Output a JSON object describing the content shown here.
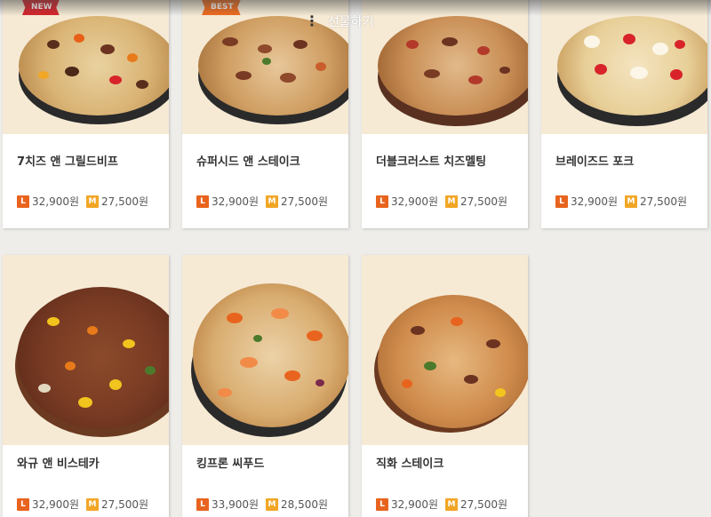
{
  "header": {
    "gift_label": "선물하기",
    "menu_dots": "⋮"
  },
  "colors": {
    "size_l": "#e8641e",
    "size_m": "#f2a626",
    "badge_new": "#d8232a",
    "badge_best": "#f26b1d",
    "photo_bg": "#f6ead5",
    "page_bg": "#eeedea"
  },
  "menu": [
    {
      "name": "7치즈 앤 그릴드비프",
      "badge": "NEW",
      "l_size": "L",
      "l_price": "32,900원",
      "m_size": "M",
      "m_price": "27,500원"
    },
    {
      "name": "슈퍼시드 앤 스테이크",
      "badge": "BEST",
      "l_size": "L",
      "l_price": "32,900원",
      "m_size": "M",
      "m_price": "27,500원"
    },
    {
      "name": "더블크러스트 치즈멜팅",
      "badge": "",
      "l_size": "L",
      "l_price": "32,900원",
      "m_size": "M",
      "m_price": "27,500원"
    },
    {
      "name": "브레이즈드 포크",
      "badge": "",
      "l_size": "L",
      "l_price": "32,900원",
      "m_size": "M",
      "m_price": "27,500원"
    },
    {
      "name": "와규 앤 비스테카",
      "badge": "",
      "l_size": "L",
      "l_price": "32,900원",
      "m_size": "M",
      "m_price": "27,500원"
    },
    {
      "name": "킹프론 씨푸드",
      "badge": "",
      "l_size": "L",
      "l_price": "33,900원",
      "m_size": "M",
      "m_price": "28,500원"
    },
    {
      "name": "직화 스테이크",
      "badge": "",
      "l_size": "L",
      "l_price": "32,900원",
      "m_size": "M",
      "m_price": "27,500원"
    }
  ]
}
